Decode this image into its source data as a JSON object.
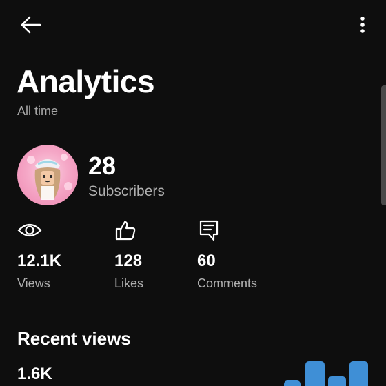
{
  "header": {
    "back_icon": "arrow-left-icon",
    "menu_icon": "more-vertical-icon"
  },
  "page": {
    "title": "Analytics",
    "subtitle": "All time"
  },
  "channel": {
    "subscriber_count": "28",
    "subscriber_label": "Subscribers"
  },
  "stats": [
    {
      "icon": "eye-icon",
      "value": "12.1K",
      "label": "Views"
    },
    {
      "icon": "thumbs-up-icon",
      "value": "128",
      "label": "Likes"
    },
    {
      "icon": "comment-icon",
      "value": "60",
      "label": "Comments"
    }
  ],
  "recent": {
    "title": "Recent views",
    "value": "1.6K"
  },
  "colors": {
    "background": "#0e0e0e",
    "text": "#ffffff",
    "muted": "#b0b0b0",
    "accent_bar": "#3f8fd6"
  }
}
